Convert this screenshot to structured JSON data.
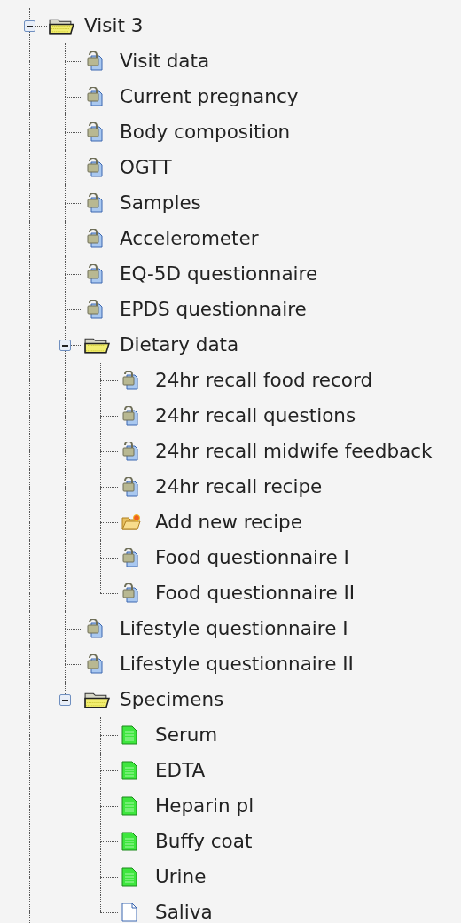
{
  "tree": [
    {
      "label": "Visit 3",
      "kind": "folder",
      "expanded": true,
      "children": [
        {
          "label": "Visit data",
          "kind": "locked"
        },
        {
          "label": "Current pregnancy",
          "kind": "locked"
        },
        {
          "label": "Body composition",
          "kind": "locked"
        },
        {
          "label": "OGTT",
          "kind": "locked"
        },
        {
          "label": "Samples",
          "kind": "locked"
        },
        {
          "label": "Accelerometer",
          "kind": "locked"
        },
        {
          "label": "EQ-5D questionnaire",
          "kind": "locked"
        },
        {
          "label": "EPDS questionnaire",
          "kind": "locked"
        },
        {
          "label": "Dietary data",
          "kind": "folder",
          "expanded": true,
          "children": [
            {
              "label": "24hr recall food record",
              "kind": "locked"
            },
            {
              "label": "24hr recall questions",
              "kind": "locked"
            },
            {
              "label": "24hr recall midwife feedback",
              "kind": "locked"
            },
            {
              "label": "24hr recall recipe",
              "kind": "locked"
            },
            {
              "label": "Add new recipe",
              "kind": "new"
            },
            {
              "label": "Food questionnaire I",
              "kind": "locked"
            },
            {
              "label": "Food questionnaire II",
              "kind": "locked"
            }
          ]
        },
        {
          "label": "Lifestyle questionnaire I",
          "kind": "locked"
        },
        {
          "label": "Lifestyle questionnaire II",
          "kind": "locked"
        },
        {
          "label": "Specimens",
          "kind": "folder",
          "expanded": true,
          "children": [
            {
              "label": "Serum",
              "kind": "complete"
            },
            {
              "label": "EDTA",
              "kind": "complete"
            },
            {
              "label": "Heparin pl",
              "kind": "complete"
            },
            {
              "label": "Buffy coat",
              "kind": "complete"
            },
            {
              "label": "Urine",
              "kind": "complete"
            },
            {
              "label": "Saliva",
              "kind": "empty"
            }
          ]
        }
      ]
    }
  ]
}
